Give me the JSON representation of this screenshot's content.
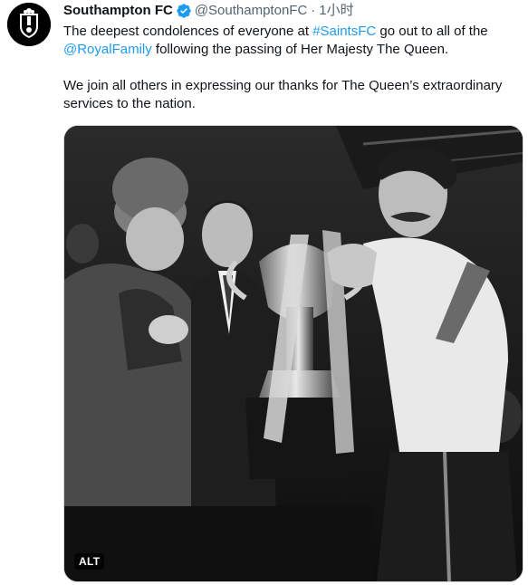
{
  "account": {
    "display_name": "Southampton FC",
    "handle": "@SouthamptonFC",
    "separator": "·",
    "timestamp": "1小时",
    "verified_color": "#1d9bf0"
  },
  "tweet": {
    "p1_pre": "The deepest condolences of everyone at ",
    "p1_hashtag": "#SaintsFC",
    "p1_mid": " go out to all of the",
    "p1_mention": "@RoyalFamily",
    "p1_post": " following the passing of Her Majesty The Queen.",
    "p2": "We join all others in expressing our thanks for The Queen’s extraordinary services to the nation."
  },
  "media": {
    "alt_label": "ALT",
    "style": "black-and-white photograph"
  },
  "colors": {
    "link": "#1d9bf0",
    "secondary_text": "#536471",
    "primary_text": "#0f1419"
  }
}
